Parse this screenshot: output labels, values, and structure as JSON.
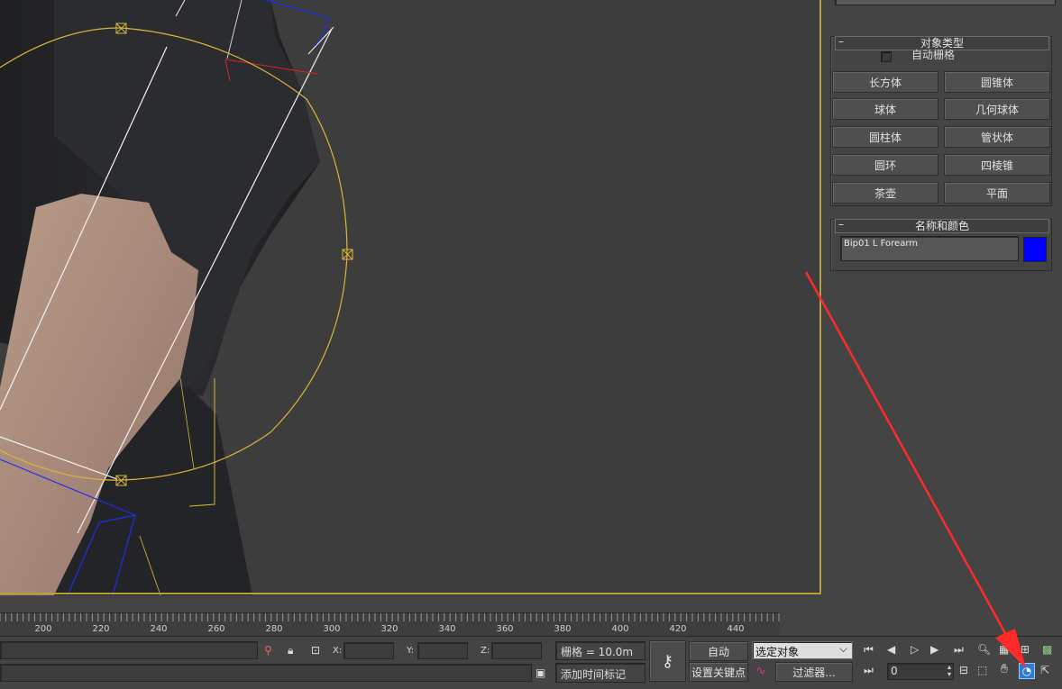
{
  "panel": {
    "object_type": {
      "title": "对象类型",
      "auto_grid_label": "自动栅格",
      "buttons": [
        "长方体",
        "圆锥体",
        "球体",
        "几何球体",
        "圆柱体",
        "管状体",
        "圆环",
        "四棱锥",
        "茶壶",
        "平面"
      ]
    },
    "name_color": {
      "title": "名称和颜色",
      "name_value": "Bip01 L Forearm",
      "color": "#0000ff"
    }
  },
  "timeline": {
    "ticks": [
      "200",
      "220",
      "240",
      "260",
      "280",
      "300",
      "320",
      "340",
      "360",
      "380",
      "400",
      "420",
      "440"
    ]
  },
  "status": {
    "x_label": "X:",
    "y_label": "Y:",
    "z_label": "Z:",
    "grid_label": "栅格 = 10.0m",
    "add_time_tag": "添加时间标记",
    "auto_key": "自动",
    "set_key": "设置关键点",
    "selection_dropdown": "选定对象",
    "filters": "过滤器...",
    "frame_value": "0"
  },
  "colors": {
    "viewport_border": "#b8a13a",
    "accent_red_arrow": "#ff2a2a",
    "selection_color": "#0000ff"
  }
}
